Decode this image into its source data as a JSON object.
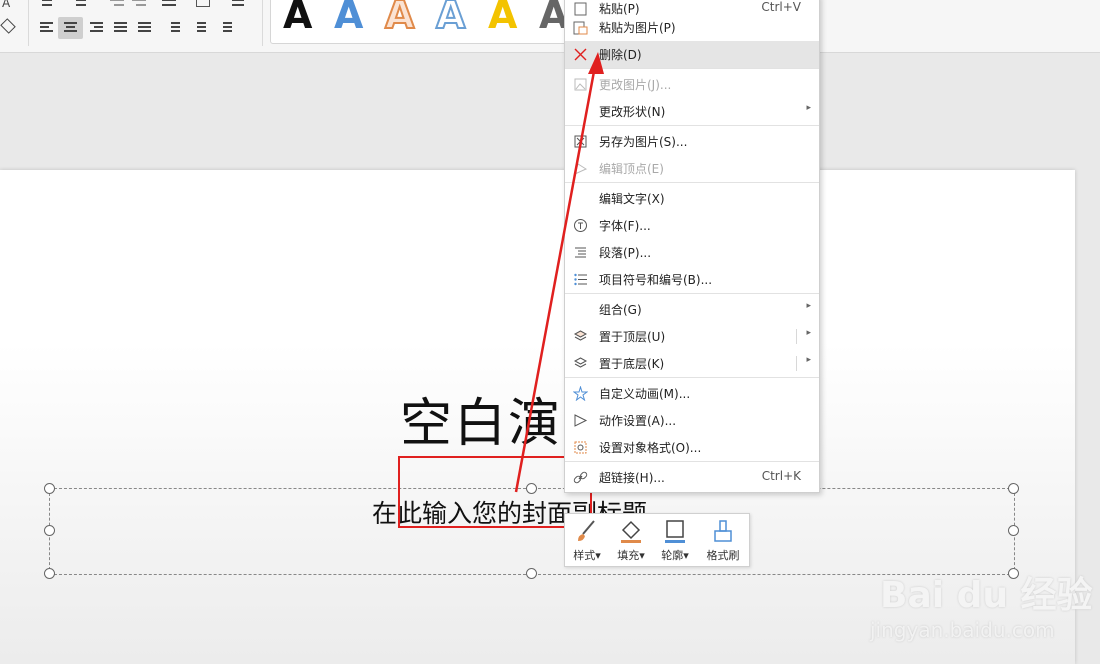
{
  "context_menu": {
    "items": [
      {
        "label": "粘贴(P)",
        "shortcut": "Ctrl+V",
        "icon": "paste-icon",
        "state": "normal"
      },
      {
        "label": "粘贴为图片(P)",
        "icon": "paste-as-picture-icon",
        "state": "normal"
      },
      {
        "label": "删除(D)",
        "icon": "delete-x-icon",
        "state": "highlighted"
      },
      {
        "label": "更改图片(J)...",
        "icon": "change-picture-icon",
        "state": "disabled"
      },
      {
        "label": "更改形状(N)",
        "submenu": true,
        "state": "normal"
      },
      {
        "label": "另存为图片(S)...",
        "icon": "save-as-picture-icon",
        "state": "normal"
      },
      {
        "label": "编辑顶点(E)",
        "icon": "edit-points-icon",
        "state": "disabled"
      },
      {
        "label": "编辑文字(X)",
        "state": "normal"
      },
      {
        "label": "字体(F)...",
        "icon": "font-icon",
        "state": "normal"
      },
      {
        "label": "段落(P)...",
        "icon": "paragraph-icon",
        "state": "normal"
      },
      {
        "label": "项目符号和编号(B)...",
        "icon": "bullets-icon",
        "state": "normal"
      },
      {
        "label": "组合(G)",
        "submenu": true,
        "state": "normal"
      },
      {
        "label": "置于顶层(U)",
        "icon": "bring-to-front-icon",
        "submenu": true,
        "state": "normal"
      },
      {
        "label": "置于底层(K)",
        "icon": "send-to-back-icon",
        "submenu": true,
        "state": "normal"
      },
      {
        "label": "自定义动画(M)...",
        "icon": "custom-animation-icon",
        "state": "normal"
      },
      {
        "label": "动作设置(A)...",
        "icon": "action-settings-icon",
        "state": "normal"
      },
      {
        "label": "设置对象格式(O)...",
        "icon": "format-object-icon",
        "state": "normal"
      },
      {
        "label": "超链接(H)...",
        "shortcut": "Ctrl+K",
        "icon": "hyperlink-icon",
        "state": "normal"
      }
    ]
  },
  "slide": {
    "title": "空白演",
    "subtitle": "在此输入您的封面副标题"
  },
  "float_toolbar": {
    "buttons": [
      {
        "label": "样式",
        "icon": "style-brush-icon"
      },
      {
        "label": "填充",
        "icon": "fill-bucket-icon"
      },
      {
        "label": "轮廓",
        "icon": "outline-icon"
      },
      {
        "label": "格式刷",
        "icon": "format-painter-icon"
      }
    ]
  },
  "ribbon": {
    "wordart_letter": "A",
    "wordart_colors": [
      "#111111",
      "#4f8fd6",
      "#e08a4a",
      "#6a9fd4",
      "#f3c300",
      "#666666"
    ]
  },
  "watermark": {
    "logo": "Bai du 经验",
    "url": "jingyan.baidu.com"
  },
  "colors": {
    "annotation_red": "#e0201f",
    "menu_highlight": "#e5e5e5"
  }
}
